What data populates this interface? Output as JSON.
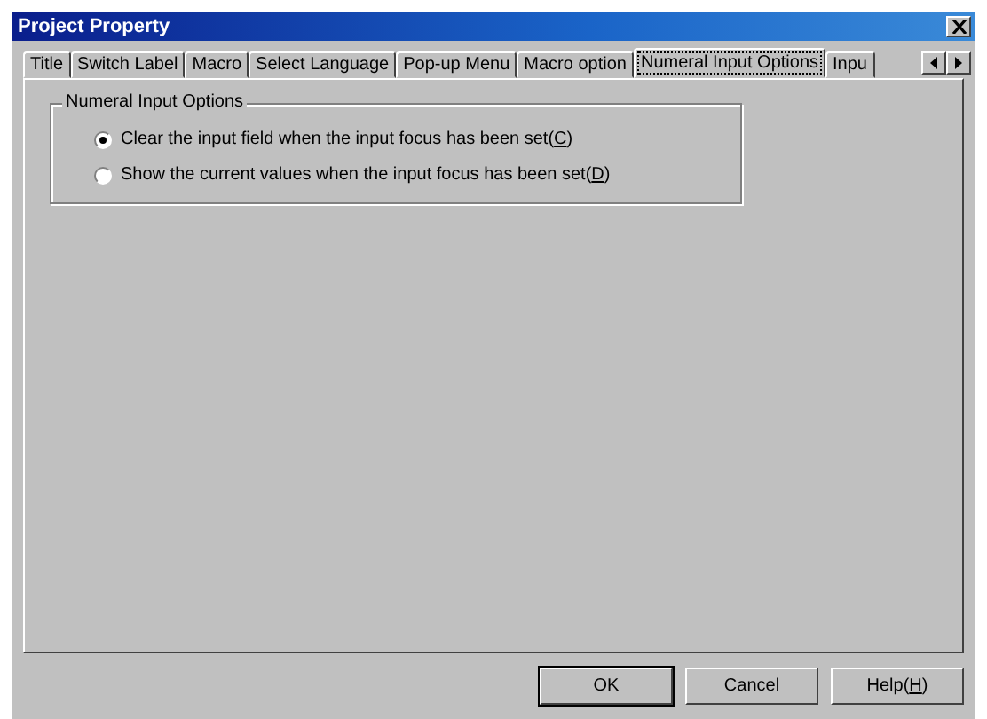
{
  "window": {
    "title": "Project Property"
  },
  "tabs": [
    {
      "label": "Title",
      "selected": false
    },
    {
      "label": "Switch Label",
      "selected": false
    },
    {
      "label": "Macro",
      "selected": false
    },
    {
      "label": "Select Language",
      "selected": false
    },
    {
      "label": "Pop-up Menu",
      "selected": false
    },
    {
      "label": "Macro option",
      "selected": false
    },
    {
      "label": "Numeral Input Options",
      "selected": true
    },
    {
      "label": "Inpu",
      "selected": false
    }
  ],
  "group": {
    "title": "Numeral Input Options",
    "options": [
      {
        "text": "Clear the input field when the input focus has been set(",
        "accelerator": "C",
        "tail": ")",
        "selected": true
      },
      {
        "text": "Show the current values when the input focus has been set(",
        "accelerator": "D",
        "tail": ")",
        "selected": false
      }
    ]
  },
  "buttons": [
    {
      "text": "OK",
      "default": true
    },
    {
      "text": "Cancel",
      "default": false
    },
    {
      "text": "Help(",
      "accelerator": "H",
      "tail": ")",
      "default": false
    }
  ]
}
